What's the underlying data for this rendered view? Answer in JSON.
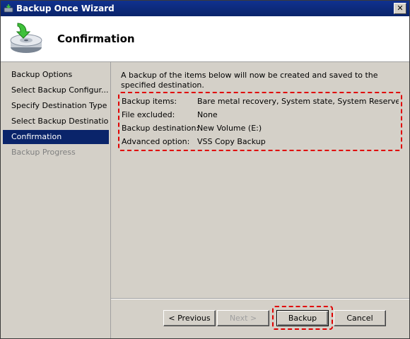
{
  "window": {
    "title": "Backup Once Wizard",
    "close_label": "✕"
  },
  "header": {
    "title": "Confirmation",
    "icon": "backup-drive-icon"
  },
  "sidebar": {
    "items": [
      {
        "label": "Backup Options"
      },
      {
        "label": "Select Backup Configur..."
      },
      {
        "label": "Specify Destination Type"
      },
      {
        "label": "Select Backup Destination"
      },
      {
        "label": "Confirmation"
      },
      {
        "label": "Backup Progress"
      }
    ]
  },
  "main": {
    "intro": "A backup of the items below will now be created and saved to the specified destination.",
    "details": [
      {
        "label": "Backup items:",
        "value": "Bare metal recovery, System state, System Reserved, L..."
      },
      {
        "label": "File excluded:",
        "value": "None"
      },
      {
        "label": "Backup destination:",
        "value": "New Volume (E:)"
      },
      {
        "label": "Advanced option:",
        "value": "VSS Copy Backup"
      }
    ]
  },
  "buttons": {
    "previous": "< Previous",
    "next": "Next >",
    "backup": "Backup",
    "cancel": "Cancel"
  },
  "colors": {
    "titlebar": "#0a246a",
    "selected": "#0a246a",
    "highlight": "#e00000"
  }
}
